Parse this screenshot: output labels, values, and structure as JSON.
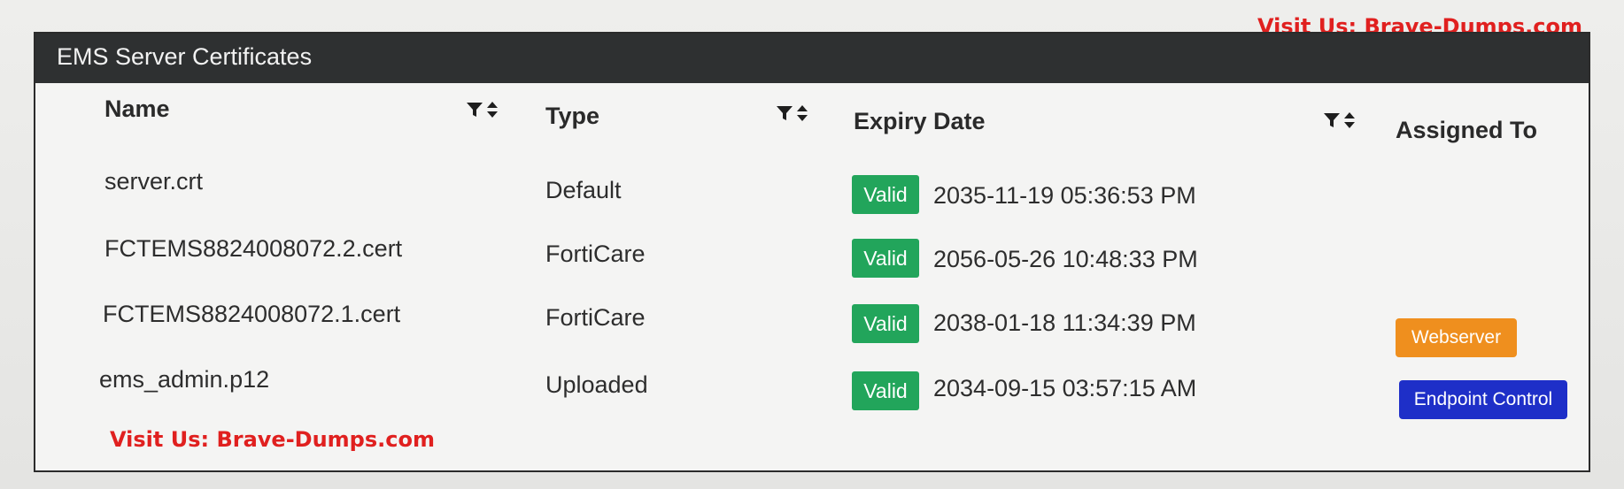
{
  "watermark": {
    "top": "Visit Us: Brave-Dumps.com",
    "bottom": "Visit Us: Brave-Dumps.com"
  },
  "panel": {
    "title": "EMS Server Certificates"
  },
  "columns": {
    "name": "Name",
    "type": "Type",
    "expiry": "Expiry Date",
    "assigned": "Assigned To"
  },
  "icons": {
    "filter": "filter-icon",
    "sort": "sort-icon"
  },
  "colors": {
    "header_bg": "#2e3031",
    "valid_badge": "#22a55b",
    "webserver_badge": "#ef8f1e",
    "endpoint_badge": "#1e2fc8",
    "watermark": "#e0201f"
  },
  "rows": [
    {
      "name": "server.crt",
      "type": "Default",
      "status": "Valid",
      "expiry": "2035-11-19 05:36:53 PM",
      "assigned": ""
    },
    {
      "name": "FCTEMS8824008072.2.cert",
      "type": "FortiCare",
      "status": "Valid",
      "expiry": "2056-05-26 10:48:33 PM",
      "assigned": ""
    },
    {
      "name": "FCTEMS8824008072.1.cert",
      "type": "FortiCare",
      "status": "Valid",
      "expiry": "2038-01-18 11:34:39 PM",
      "assigned": "Webserver"
    },
    {
      "name": "ems_admin.p12",
      "type": "Uploaded",
      "status": "Valid",
      "expiry": "2034-09-15 03:57:15 AM",
      "assigned": "Endpoint Control"
    }
  ]
}
